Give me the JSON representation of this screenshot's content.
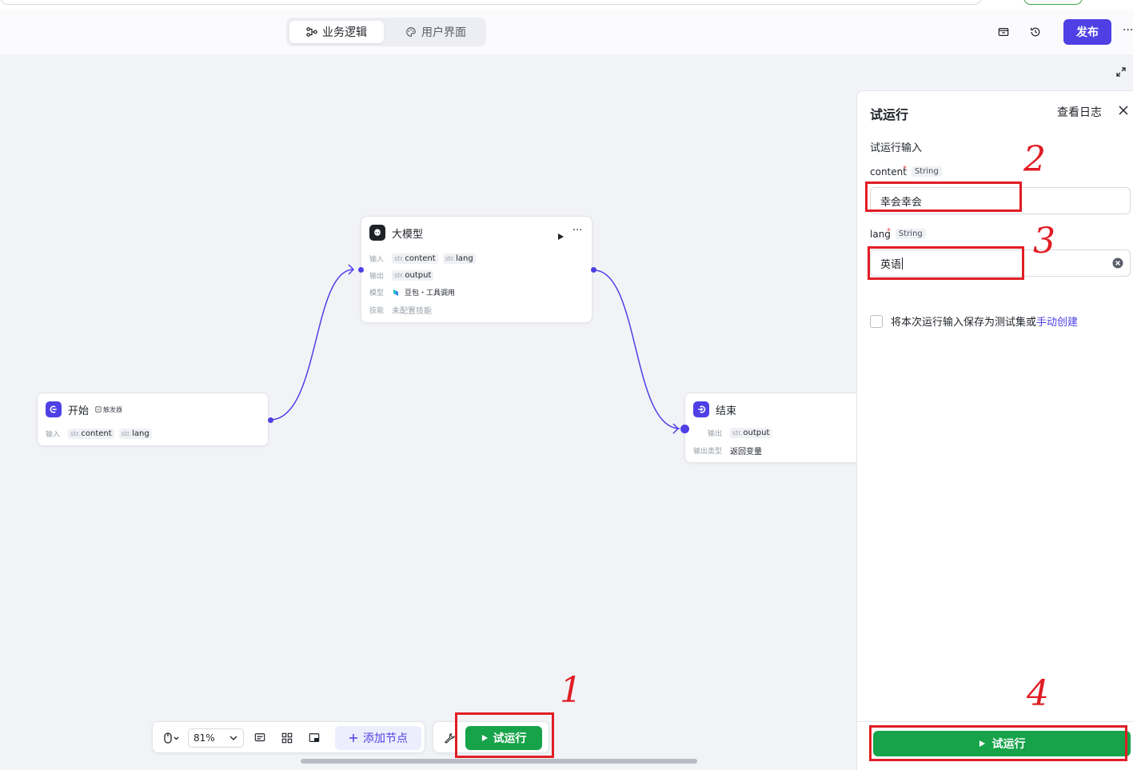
{
  "header": {
    "tabs": [
      {
        "label": "业务逻辑",
        "icon": "workflow-icon",
        "active": true
      },
      {
        "label": "用户界面",
        "icon": "palette-icon",
        "active": false
      }
    ],
    "publish_label": "发布",
    "more_label": "···"
  },
  "nodes": {
    "start": {
      "title": "开始",
      "trigger_label": "触发器",
      "input_label": "输入",
      "inputs": [
        {
          "type": "str.",
          "name": "content"
        },
        {
          "type": "str.",
          "name": "lang"
        }
      ]
    },
    "llm": {
      "title": "大模型",
      "more_label": "···",
      "input_label": "输入",
      "inputs": [
        {
          "type": "str.",
          "name": "content"
        },
        {
          "type": "str.",
          "name": "lang"
        }
      ],
      "output_label": "输出",
      "outputs": [
        {
          "type": "str.",
          "name": "output"
        }
      ],
      "model_label": "模型",
      "model_value": "豆包・工具调用",
      "skill_label": "技能",
      "skill_value": "未配置技能"
    },
    "end": {
      "title": "结束",
      "output_label": "输出",
      "outputs": [
        {
          "type": "str.",
          "name": "output"
        }
      ],
      "output_type_label": "输出类型",
      "output_type_value": "返回变量"
    }
  },
  "toolbar": {
    "zoom": "81%",
    "add_node_label": "添加节点",
    "run_label": "试运行"
  },
  "panel": {
    "title": "试运行",
    "log_label": "查看日志",
    "section_label": "试运行输入",
    "fields": [
      {
        "name": "content",
        "required_mark": "*",
        "type": "String",
        "value": "幸会幸会"
      },
      {
        "name": "lang",
        "required_mark": "*",
        "type": "String",
        "value": "英语"
      }
    ],
    "save_text": "将本次运行输入保存为测试集或",
    "save_link": "手动创建",
    "run_label": "试运行"
  },
  "annotations": [
    "1",
    "2",
    "3",
    "4"
  ],
  "colors": {
    "accent": "#4e40e5",
    "run_green": "#17a34a",
    "annotation_red": "#e11d25"
  }
}
